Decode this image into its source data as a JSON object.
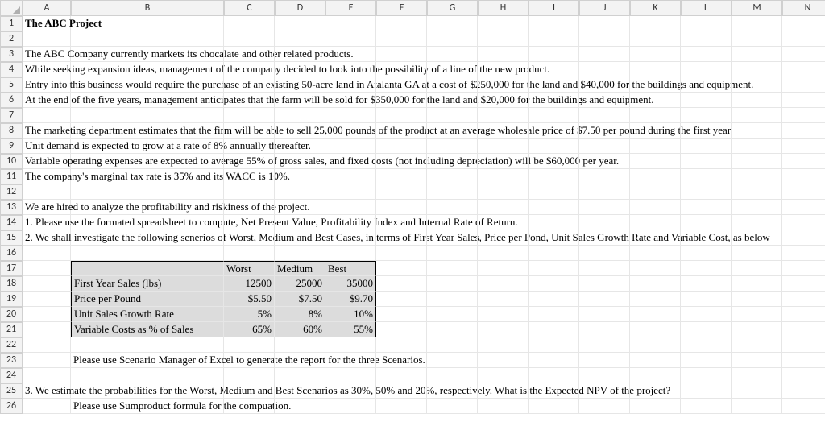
{
  "columns": [
    "A",
    "B",
    "C",
    "D",
    "E",
    "F",
    "G",
    "H",
    "I",
    "J",
    "K",
    "L",
    "M",
    "N"
  ],
  "row_count": 26,
  "rows": {
    "r1": {
      "A": "The ABC Project"
    },
    "r3": {
      "A": "The ABC Company currently markets its chocalate and other related products."
    },
    "r4": {
      "A": "While seeking expansion ideas, management of the company decided to look into the possibility of a line of the new product."
    },
    "r5": {
      "A": "Entry into this business would require the purchase of an existing 50-acre land in Atalanta GA at a cost of $250,000 for the land and $40,000 for the buildings and equipment."
    },
    "r6": {
      "A": "At the end of the five years, management anticipates that the farm will be sold for $350,000 for the land and $20,000 for the buildings and equipment."
    },
    "r8": {
      "A": "The marketing department estimates that the firm will be able to sell 25,000 pounds of the product at an average wholesale price of $7.50 per pound during the first year."
    },
    "r9": {
      "A": "Unit demand is expected to grow at a rate of 8% annually thereafter."
    },
    "r10": {
      "A": "Variable operating expenses are expected to average 55% of gross sales, and fixed costs (not including depreciation) will be $60,000 per year."
    },
    "r11": {
      "A": "The company's marginal tax rate is 35% and its WACC is 10%."
    },
    "r13": {
      "A": "We are hired to analyze the profitability and riskiness of the project."
    },
    "r14": {
      "A": "1. Please use the formated spreadsheet to compute, Net Present Value, Profitability Index and Internal Rate of Return."
    },
    "r15": {
      "A": "2. We shall investigate the following senerios of Worst, Medium and Best Cases, in terms of First Year Sales, Price per Pond, Unit Sales Growth Rate and Variable Cost, as below"
    },
    "r17": {
      "C": "Worst",
      "D": "Medium",
      "E": "Best"
    },
    "r18": {
      "B": "First Year Sales (lbs)",
      "C": "12500",
      "D": "25000",
      "E": "35000"
    },
    "r19": {
      "B": "Price per Pound",
      "C": "$5.50",
      "D": "$7.50",
      "E": "$9.70"
    },
    "r20": {
      "B": "Unit Sales Growth Rate",
      "C": "5%",
      "D": "8%",
      "E": "10%"
    },
    "r21": {
      "B": "Variable Costs as % of Sales",
      "C": "65%",
      "D": "60%",
      "E": "55%"
    },
    "r23": {
      "B": "Please use Scenario Manager of Excel to generate the report for the three Scenarios."
    },
    "r25": {
      "A": "3. We estimate the probabilities for the Worst, Medium and Best Scenarios as 30%, 50% and 20%, respectively. What is the Expected NPV of the project?"
    },
    "r26": {
      "B": "Please use Sumproduct formula for the compuation."
    }
  },
  "chart_data": {
    "type": "table",
    "title": "Scenario Assumptions",
    "columns": [
      "Worst",
      "Medium",
      "Best"
    ],
    "rows": [
      {
        "label": "First Year Sales (lbs)",
        "values": [
          12500,
          25000,
          35000
        ]
      },
      {
        "label": "Price per Pound",
        "values": [
          5.5,
          7.5,
          9.7
        ],
        "unit": "$"
      },
      {
        "label": "Unit Sales Growth Rate",
        "values": [
          0.05,
          0.08,
          0.1
        ],
        "unit": "%"
      },
      {
        "label": "Variable Costs as % of Sales",
        "values": [
          0.65,
          0.6,
          0.55
        ],
        "unit": "%"
      }
    ],
    "probabilities": {
      "Worst": 0.3,
      "Medium": 0.5,
      "Best": 0.2
    }
  }
}
